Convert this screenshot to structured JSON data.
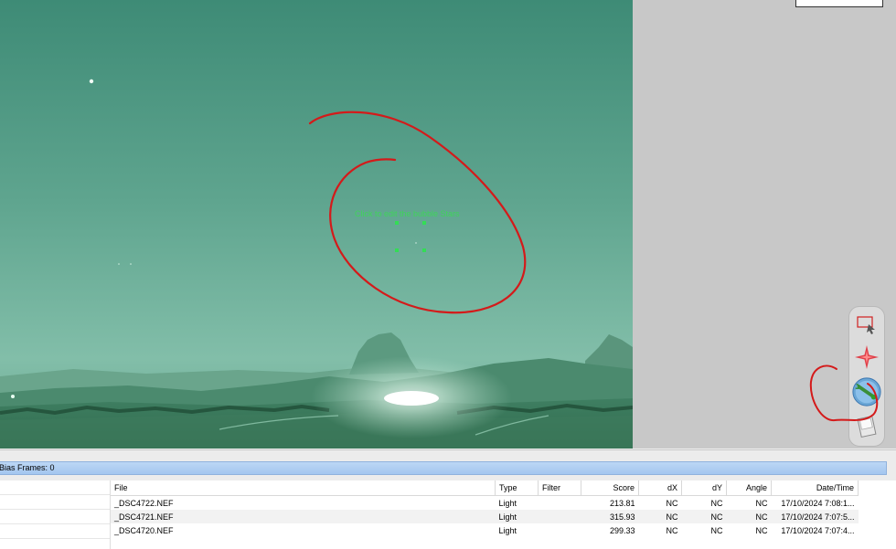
{
  "overlay": {
    "caption": "Click to edit the bubble Stars"
  },
  "status": {
    "bias_frames": "Bias Frames: 0"
  },
  "table": {
    "columns": [
      "File",
      "Type",
      "Filter",
      "Score",
      "dX",
      "dY",
      "Angle",
      "Date/Time"
    ],
    "rows": [
      {
        "file": "_DSC4722.NEF",
        "type": "Light",
        "filter": "",
        "score": "213.81",
        "dx": "NC",
        "dy": "NC",
        "angle": "NC",
        "datetime": "17/10/2024 7:08:1..."
      },
      {
        "file": "_DSC4721.NEF",
        "type": "Light",
        "filter": "",
        "score": "315.93",
        "dx": "NC",
        "dy": "NC",
        "angle": "NC",
        "datetime": "17/10/2024 7:07:5..."
      },
      {
        "file": "_DSC4720.NEF",
        "type": "Light",
        "filter": "",
        "score": "299.33",
        "dx": "NC",
        "dy": "NC",
        "angle": "NC",
        "datetime": "17/10/2024 7:07:4..."
      }
    ]
  },
  "toolbar": {
    "tools": [
      "select-rectangle-icon",
      "star-edit-icon",
      "comet-edit-icon",
      "save-delta-icon"
    ]
  },
  "colors": {
    "sky_top": "#3c8a75",
    "sky_bottom": "#7cb8a3",
    "annotation": "#d41a1a",
    "star_marker": "#33dd55"
  }
}
